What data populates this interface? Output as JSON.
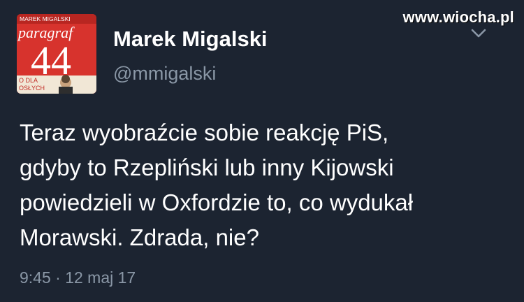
{
  "watermark": "www.wiocha.pl",
  "author": {
    "name": "Marek Migalski",
    "handle": "@mmigalski",
    "avatar": {
      "top_text": "MAREK MIGALSKI",
      "title": "paragraf",
      "number": "44",
      "bottom_text_1": "O DLA",
      "bottom_text_2": "OSŁYCH"
    }
  },
  "tweet": {
    "lines": [
      "Teraz wyobraźcie sobie reakcję PiS,",
      "gdyby to Rzepliński lub inny Kijowski",
      "powiedzieli w Oxfordzie to, co wydukał",
      "Morawski. Zdrada, nie?"
    ],
    "timestamp": "9:45 · 12 maj 17"
  },
  "colors": {
    "background": "#1c2431",
    "text_primary": "#ffffff",
    "text_secondary": "#8a97a6",
    "avatar_red": "#d7332d"
  },
  "icons": {
    "menu": "chevron-down-icon"
  }
}
